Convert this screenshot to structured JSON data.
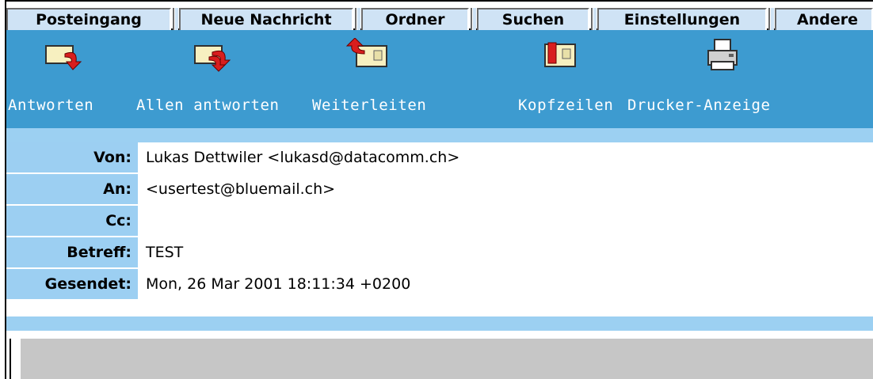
{
  "tabs": [
    {
      "label": "Posteingang"
    },
    {
      "label": "Neue Nachricht"
    },
    {
      "label": "Ordner"
    },
    {
      "label": "Suchen"
    },
    {
      "label": "Einstellungen"
    },
    {
      "label": "Andere"
    }
  ],
  "toolbar": {
    "reply": {
      "label": "Antworten",
      "icon": "reply-icon"
    },
    "reply_all": {
      "label": "Allen antworten",
      "icon": "reply-all-icon"
    },
    "forward": {
      "label": "Weiterleiten",
      "icon": "forward-icon"
    },
    "headers": {
      "label": "Kopfzeilen",
      "icon": "headers-icon"
    },
    "print": {
      "label": "Drucker-Anzeige",
      "icon": "printer-icon"
    }
  },
  "headers": {
    "from": {
      "label": "Von:",
      "value": "Lukas Dettwiler <lukasd@datacomm.ch>"
    },
    "to": {
      "label": "An:",
      "value": "<usertest@bluemail.ch>"
    },
    "cc": {
      "label": "Cc:",
      "value": ""
    },
    "subject": {
      "label": "Betreff:",
      "value": "TEST"
    },
    "sent": {
      "label": "Gesendet:",
      "value": "Mon, 26 Mar 2001 18:11:34 +0200"
    }
  },
  "colors": {
    "toolbar_bg": "#3d9bd0",
    "tab_bg": "#cfe3f5",
    "header_label_bg": "#9ccff2",
    "body_gray": "#c6c6c6"
  }
}
